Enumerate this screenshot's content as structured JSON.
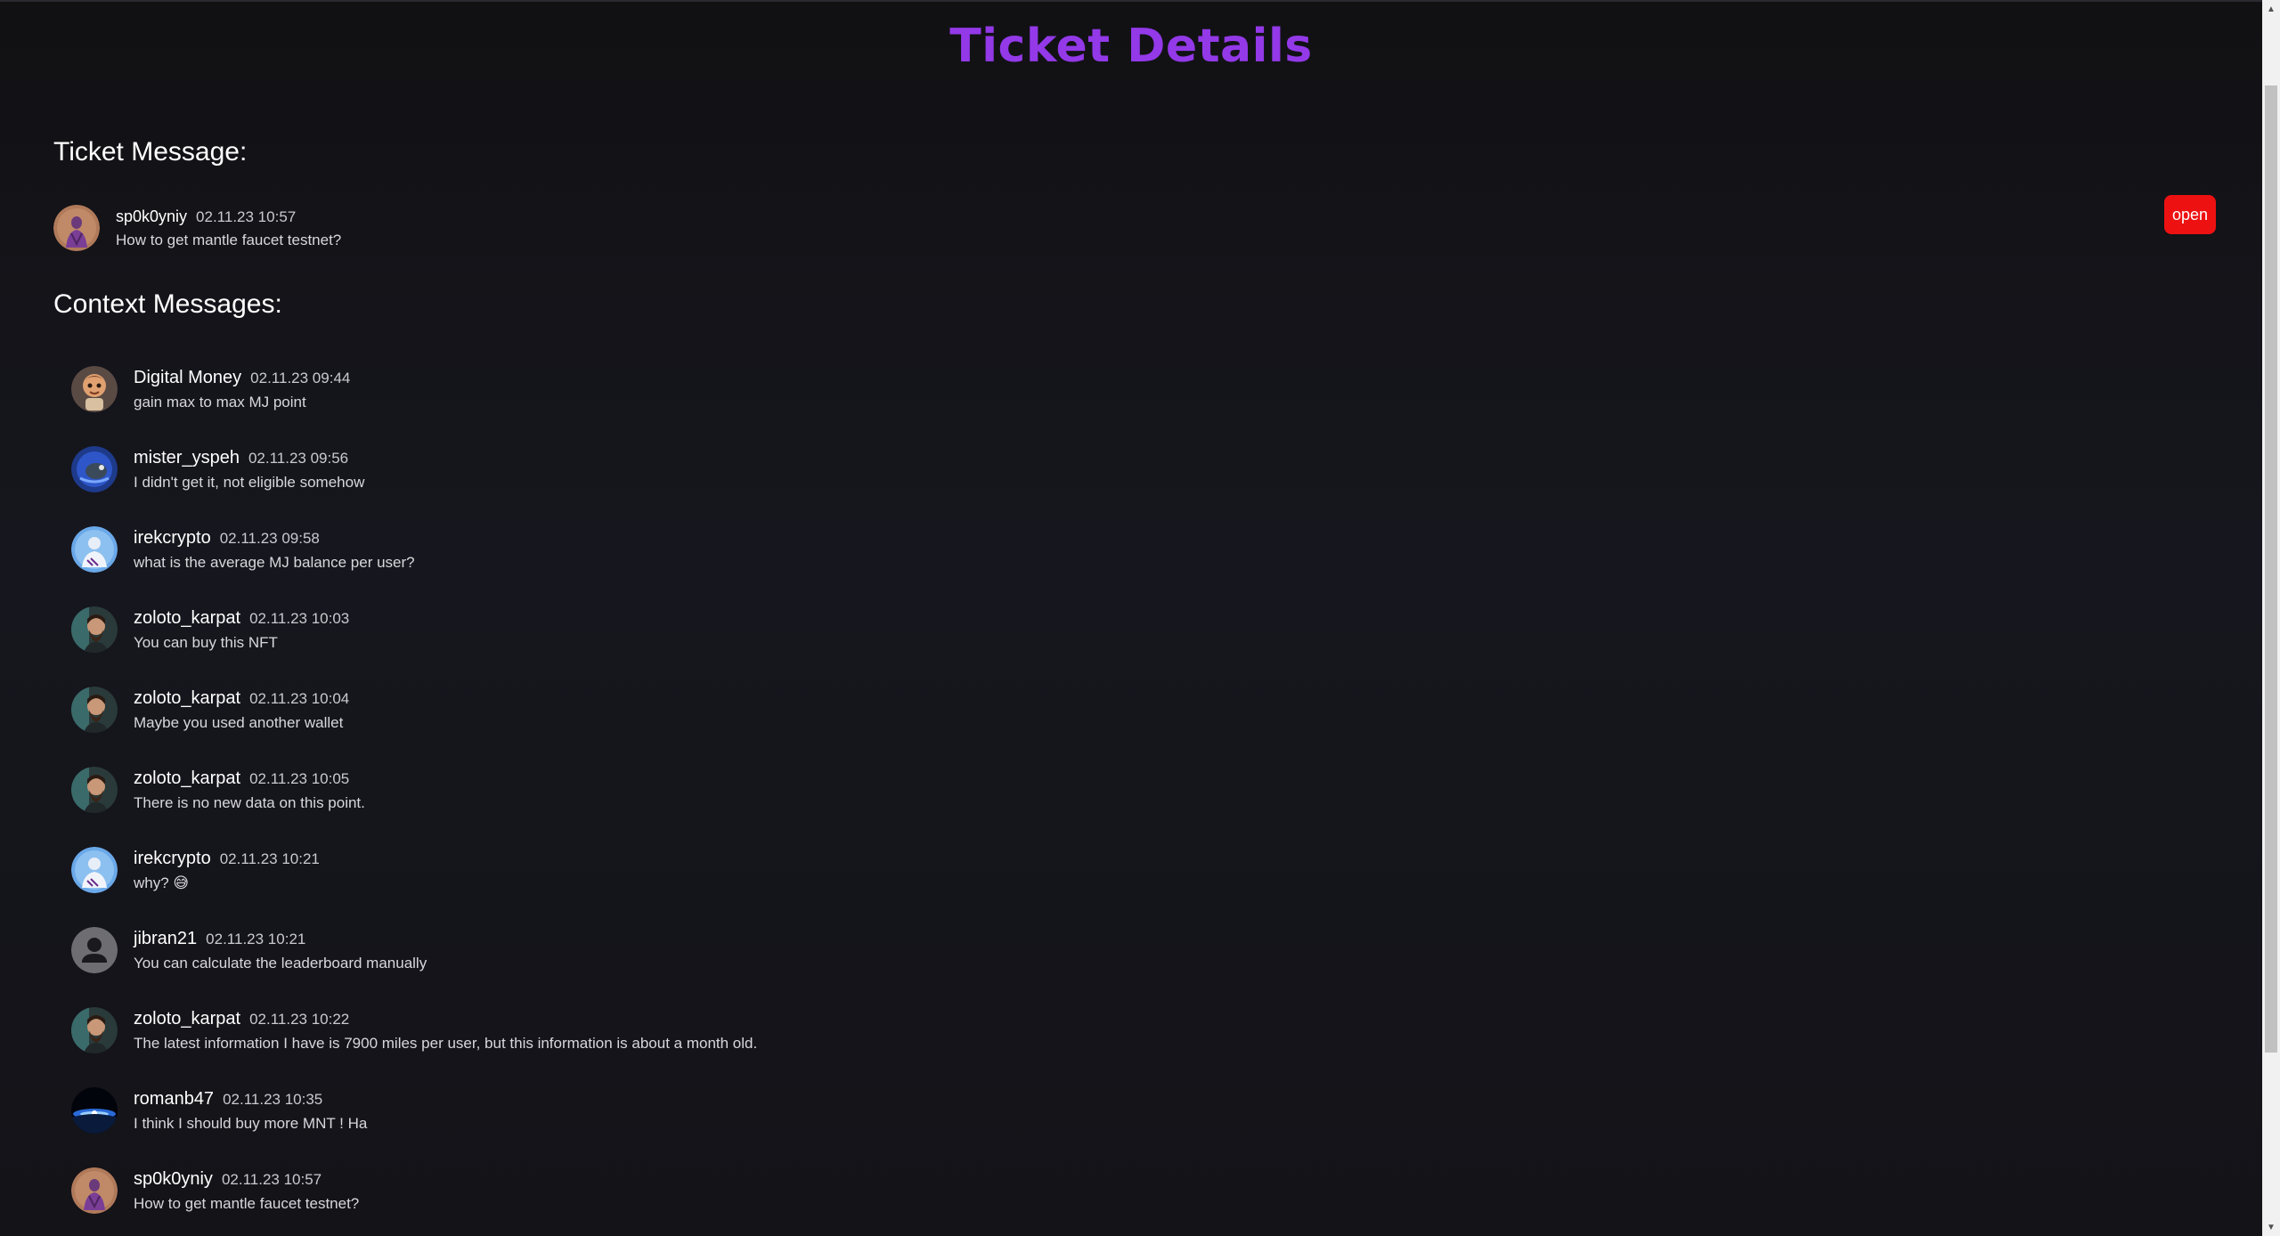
{
  "page": {
    "title": "Ticket Details"
  },
  "ticket": {
    "heading": "Ticket Message:",
    "message": {
      "author": "sp0k0yniy",
      "time": "02.11.23 10:57",
      "text": "How to get mantle faucet testnet?",
      "avatar": "purple-figure-avatar"
    },
    "status": "open",
    "status_color": "#ee1111"
  },
  "context": {
    "heading": "Context Messages:",
    "messages": [
      {
        "author": "Digital Money",
        "time": "02.11.23 09:44",
        "text": "gain max to max MJ point",
        "avatar": "cartoon-face-avatar"
      },
      {
        "author": "mister_yspeh",
        "time": "02.11.23 09:56",
        "text": "I didn't get it, not eligible somehow",
        "avatar": "blue-creature-avatar"
      },
      {
        "author": "irekcrypto",
        "time": "02.11.23 09:58",
        "text": "what is the average MJ balance per user?",
        "avatar": "light-blue-avatar"
      },
      {
        "author": "zoloto_karpat",
        "time": "02.11.23 10:03",
        "text": "You can buy this NFT",
        "avatar": "bearded-man-avatar"
      },
      {
        "author": "zoloto_karpat",
        "time": "02.11.23 10:04",
        "text": "Maybe you used another wallet",
        "avatar": "bearded-man-avatar"
      },
      {
        "author": "zoloto_karpat",
        "time": "02.11.23 10:05",
        "text": "There is no new data on this point.",
        "avatar": "bearded-man-avatar"
      },
      {
        "author": "irekcrypto",
        "time": "02.11.23 10:21",
        "text": "why? 😅",
        "avatar": "light-blue-avatar"
      },
      {
        "author": "jibran21",
        "time": "02.11.23 10:21",
        "text": "You can calculate the leaderboard manually",
        "avatar": "default-user-avatar"
      },
      {
        "author": "zoloto_karpat",
        "time": "02.11.23 10:22",
        "text": "The latest information I have is 7900 miles per user, but this information is about a month old.",
        "avatar": "bearded-man-avatar"
      },
      {
        "author": "romanb47",
        "time": "02.11.23 10:35",
        "text": "I think I should buy more MNT ! Ha",
        "avatar": "space-planet-avatar"
      },
      {
        "author": "sp0k0yniy",
        "time": "02.11.23 10:57",
        "text": "How to get mantle faucet testnet?",
        "avatar": "purple-figure-avatar"
      }
    ]
  },
  "colors": {
    "title": "#9339e8",
    "background": "#121217"
  }
}
